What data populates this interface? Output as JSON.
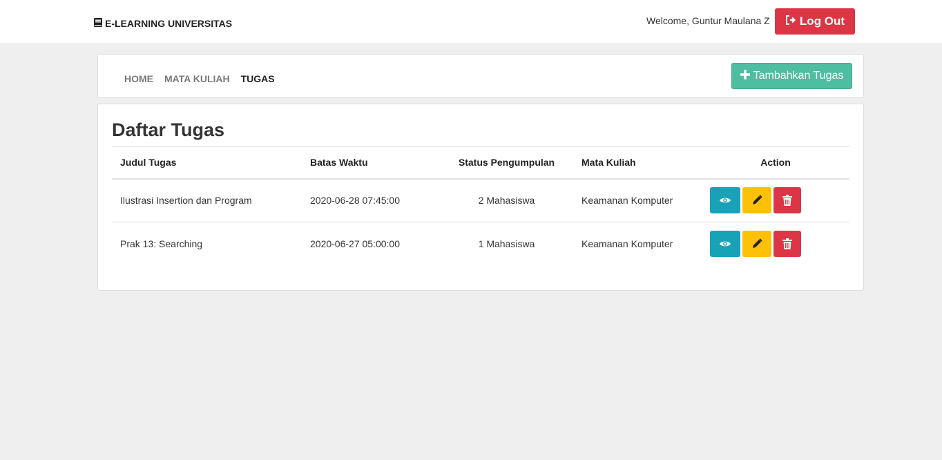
{
  "header": {
    "brand": "E-LEARNING UNIVERSITAS",
    "welcome": "Welcome, Guntur Maulana Z",
    "logout_label": "Log Out"
  },
  "nav": {
    "items": [
      {
        "label": "HOME",
        "active": false
      },
      {
        "label": "MATA KULIAH",
        "active": false
      },
      {
        "label": "TUGAS",
        "active": true
      }
    ],
    "add_label": "Tambahkan Tugas"
  },
  "main": {
    "title": "Daftar Tugas",
    "columns": [
      "Judul Tugas",
      "Batas Waktu",
      "Status Pengumpulan",
      "Mata Kuliah",
      "Action"
    ],
    "rows": [
      {
        "judul": "Ilustrasi Insertion dan Program",
        "batas": "2020-06-28 07:45:00",
        "status": "2 Mahasiswa",
        "matkul": "Keamanan Komputer"
      },
      {
        "judul": "Prak 13: Searching",
        "batas": "2020-06-27 05:00:00",
        "status": "1 Mahasiswa",
        "matkul": "Keamanan Komputer"
      }
    ]
  },
  "colors": {
    "danger": "#dc3545",
    "info": "#17a2b8",
    "warning": "#ffc107",
    "success": "#4fbd9f"
  },
  "icons": {
    "brand": "book-icon",
    "logout": "sign-out-icon",
    "add": "plus-icon",
    "view": "eye-icon",
    "edit": "pencil-icon",
    "delete": "trash-icon"
  }
}
